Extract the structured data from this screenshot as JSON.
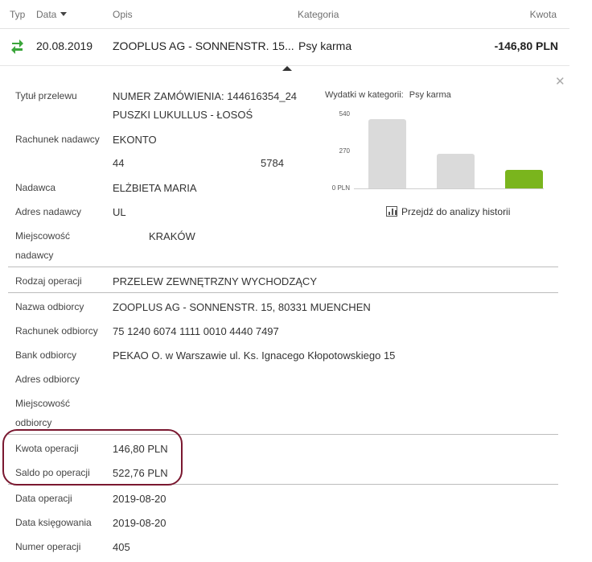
{
  "header": {
    "col_type": "Typ",
    "col_date": "Data",
    "col_desc": "Opis",
    "col_category": "Kategoria",
    "col_amount": "Kwota"
  },
  "transaction": {
    "date": "20.08.2019",
    "description": "ZOOPLUS AG - SONNENSTR. 15...",
    "category": "Psy karma",
    "amount": "-146,80 PLN",
    "type_icon": "transfer-arrows-icon",
    "type_color": "#3aa53a"
  },
  "details": {
    "title_label": "Tytuł przelewu",
    "title_line1": "NUMER ZAMÓWIENIA: 144616354_24",
    "title_line2": "PUSZKI LUKULLUS - ŁOSOŚ",
    "sender_account_label": "Rachunek nadawcy",
    "sender_account_name": "EKONTO",
    "sender_account_start": "44",
    "sender_account_end": "5784",
    "sender_label": "Nadawca",
    "sender_value": "ELŻBIETA MARIA",
    "sender_address_label": "Adres nadawcy",
    "sender_address_value": "UL",
    "sender_city_label_1": "Miejscowość",
    "sender_city_label_2": "nadawcy",
    "sender_city_value": "KRAKÓW",
    "operation_kind_label": "Rodzaj operacji",
    "operation_kind_value": "PRZELEW ZEWNĘTRZNY WYCHODZĄCY",
    "recipient_name_label": "Nazwa odbiorcy",
    "recipient_name_value": "ZOOPLUS AG - SONNENSTR. 15, 80331 MUENCHEN",
    "recipient_account_label": "Rachunek odbiorcy",
    "recipient_account_value": "75 1240 6074 1111 0010 4440 7497",
    "recipient_bank_label": "Bank odbiorcy",
    "recipient_bank_value": "PEKAO O. w Warszawie ul. Ks. Ignacego Kłopotowskiego 15",
    "recipient_address_label": "Adres odbiorcy",
    "recipient_city_label_1": "Miejscowość",
    "recipient_city_label_2": "odbiorcy",
    "amount_label": "Kwota operacji",
    "amount_value": "146,80 PLN",
    "balance_label": "Saldo po operacji",
    "balance_value": "522,76 PLN",
    "operation_date_label": "Data operacji",
    "operation_date_value": "2019-08-20",
    "booking_date_label": "Data księgowania",
    "booking_date_value": "2019-08-20",
    "operation_number_label": "Numer operacji",
    "operation_number_value": "405"
  },
  "chart": {
    "title_prefix": "Wydatki w kategorii:",
    "title_category": "Psy karma",
    "link_label": "Przejdź do analizy historii",
    "highlight_color": "#7a1830"
  },
  "chart_data": {
    "type": "bar",
    "title": "Wydatki w kategorii: Psy karma",
    "categories": [
      "",
      "",
      ""
    ],
    "values": [
      505,
      255,
      135
    ],
    "yticks": [
      "540",
      "270",
      "0 PLN"
    ],
    "ylim": [
      0,
      540
    ],
    "colors": [
      "#dadada",
      "#dadada",
      "#7ab51d"
    ]
  }
}
